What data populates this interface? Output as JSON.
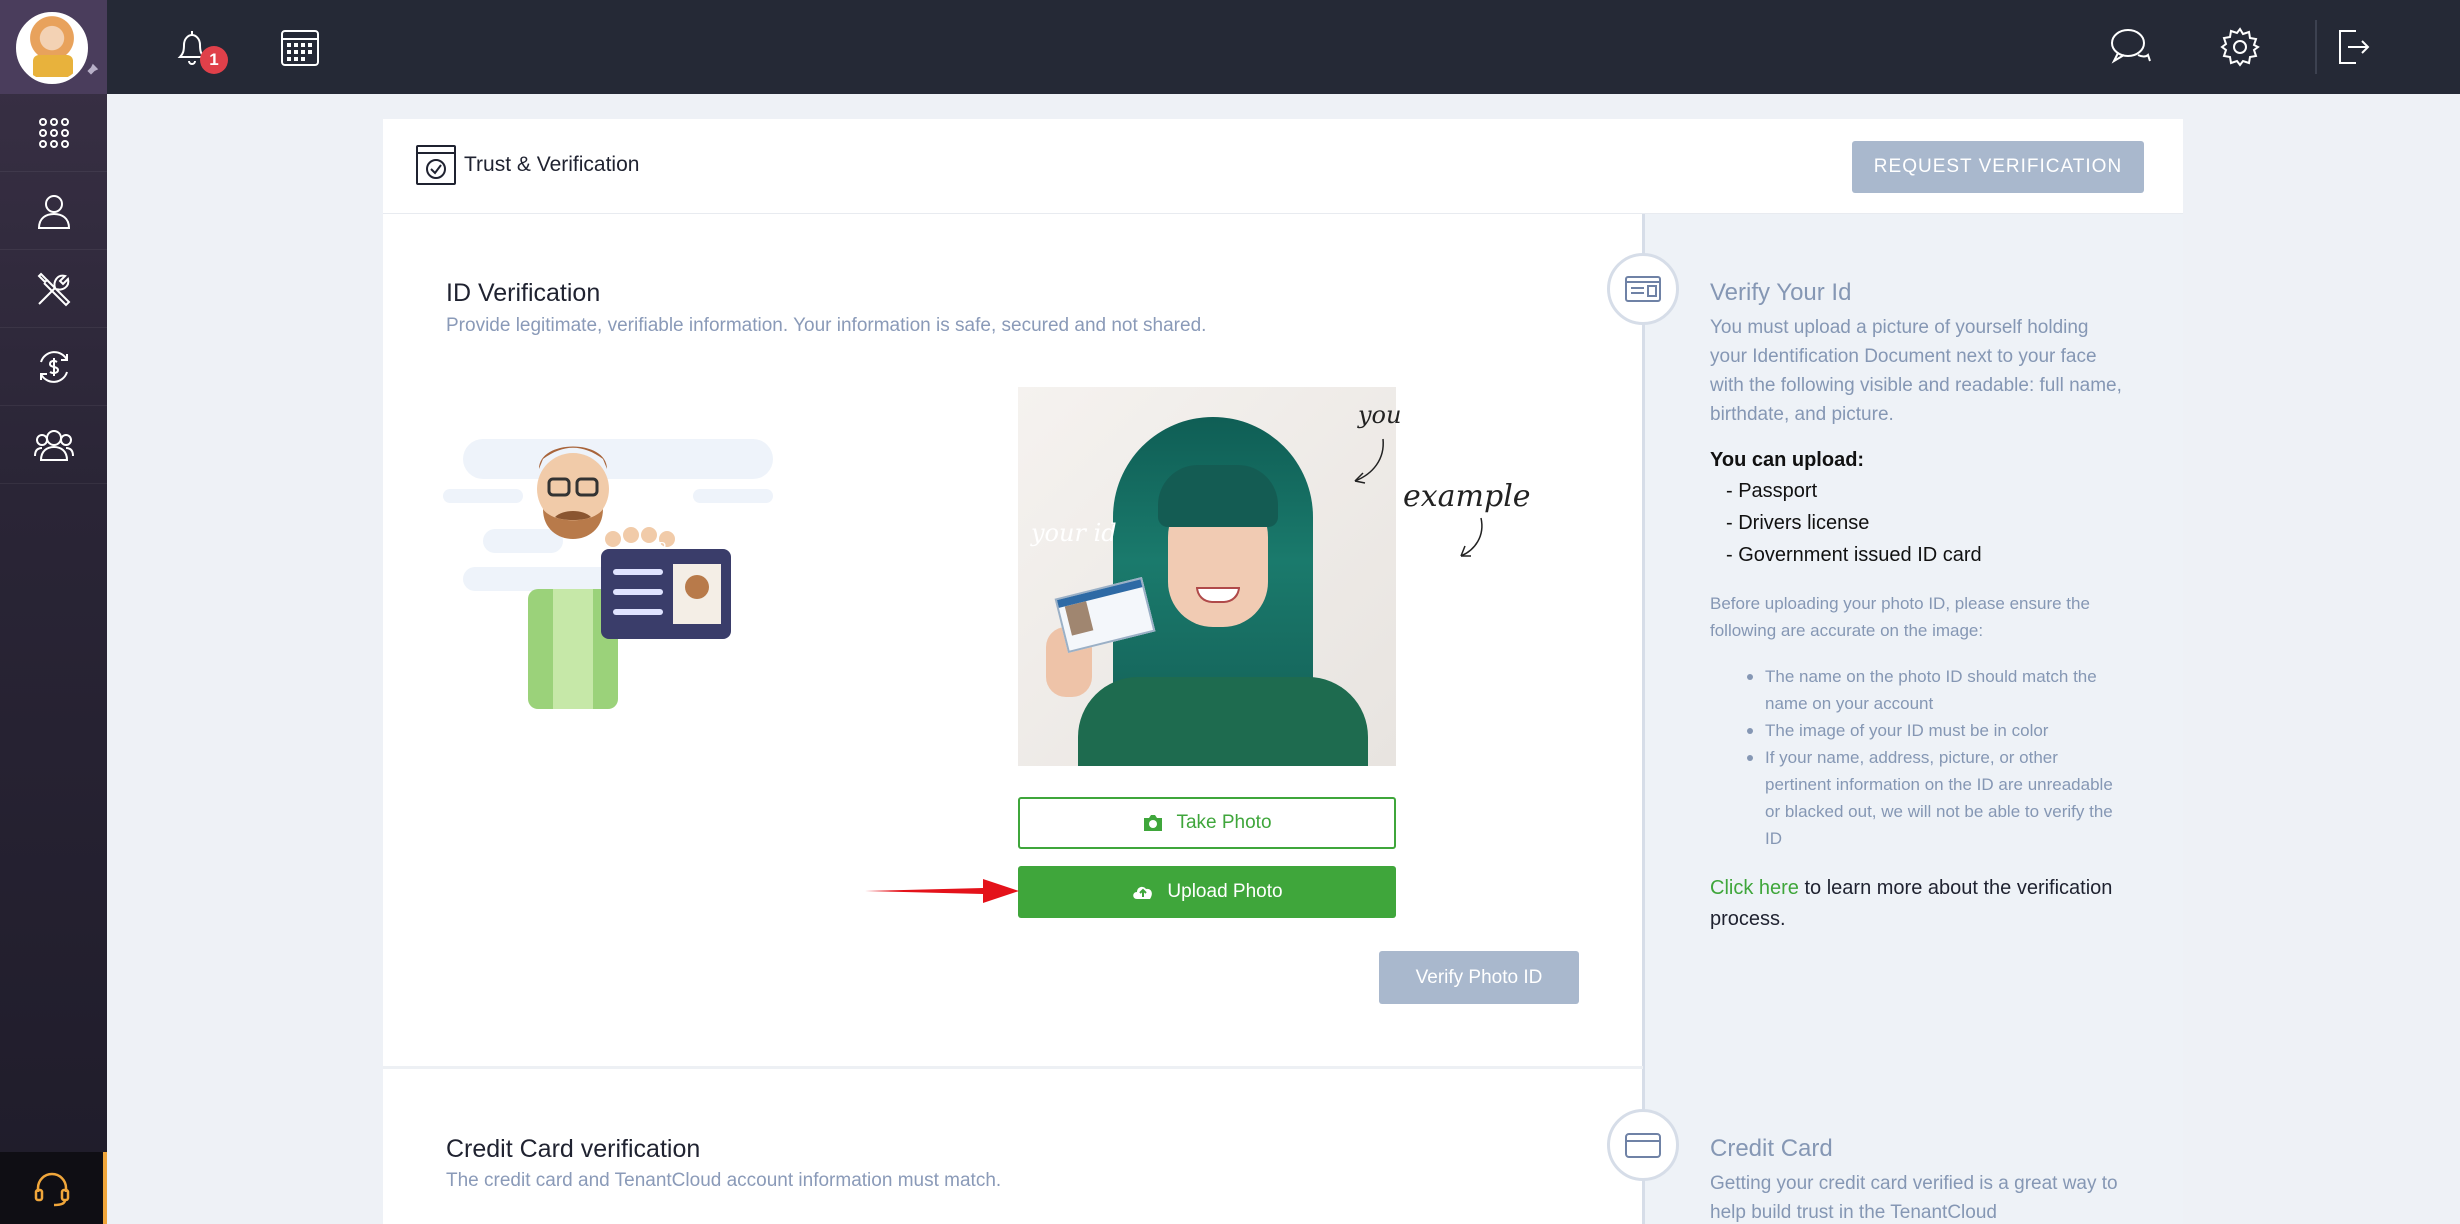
{
  "topbar": {
    "notification_count": "1",
    "icons": [
      "bell-icon",
      "calendar-icon",
      "chat-icon",
      "gear-icon",
      "logout-icon"
    ]
  },
  "sidebar": {
    "items": [
      "apps-grid-icon",
      "user-icon",
      "tools-icon",
      "finance-icon",
      "contacts-icon"
    ],
    "support_icon": "headset-icon"
  },
  "header": {
    "title": "Trust & Verification",
    "request_button": "REQUEST VERIFICATION"
  },
  "id_section": {
    "title": "ID Verification",
    "subtitle": "Provide legitimate, verifiable information. Your information is safe, secured and not shared.",
    "annotation_you": "you",
    "annotation_your_id": "your id",
    "annotation_example": "example",
    "id_card_label": "ID",
    "take_photo": "Take Photo",
    "upload_photo": "Upload Photo",
    "verify_photo": "Verify Photo ID"
  },
  "credit_section": {
    "title": "Credit Card verification",
    "subtitle": "The credit card and TenantCloud account information must match."
  },
  "right_panel": {
    "verify_title": "Verify Your Id",
    "verify_text": "You must upload a picture of yourself holding your Identification Document next to your face with the following visible and readable: full name, birthdate, and picture.",
    "you_can_upload": "You can upload:",
    "upload_options": [
      "- Passport",
      "- Drivers license",
      "- Government issued ID card"
    ],
    "before_text": "Before uploading your photo ID, please ensure the following are accurate on the image:",
    "bullets": [
      "The name on the photo ID should match the name on your account",
      "The image of your ID must be in color",
      "If your name, address, picture, or other pertinent information on the ID are unreadable or blacked out, we will not be able to verify the ID"
    ],
    "click_here": "Click here",
    "click_rest": " to learn more about the verification process.",
    "credit_title": "Credit Card",
    "credit_text": "Getting your credit card verified is a great way to help build trust in the TenantCloud"
  },
  "colors": {
    "accent_green": "#3fa63b",
    "muted_button": "#a9b8cd",
    "topbar": "#252936",
    "badge_red": "#e0404a"
  }
}
